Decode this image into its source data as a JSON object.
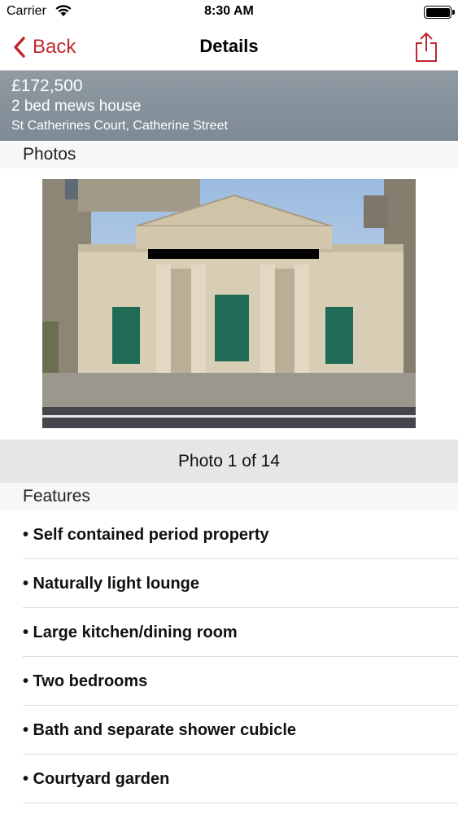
{
  "status_bar": {
    "carrier": "Carrier",
    "time": "8:30 AM"
  },
  "nav": {
    "back_label": "Back",
    "title": "Details"
  },
  "listing": {
    "price": "£172,500",
    "type": "2 bed mews house",
    "address": "St Catherines Court, Catherine Street"
  },
  "sections": {
    "photos": "Photos",
    "features": "Features"
  },
  "photo_counter": "Photo 1 of 14",
  "features": [
    "• Self contained period property",
    "• Naturally light lounge",
    "• Large kitchen/dining room",
    "• Two bedrooms",
    "• Bath and separate shower cubicle",
    "• Courtyard garden"
  ],
  "colors": {
    "accent": "#c1272d",
    "header_bg": "#86929b"
  },
  "icons": [
    "wifi-icon",
    "battery-icon",
    "chevron-left-icon",
    "share-icon"
  ]
}
